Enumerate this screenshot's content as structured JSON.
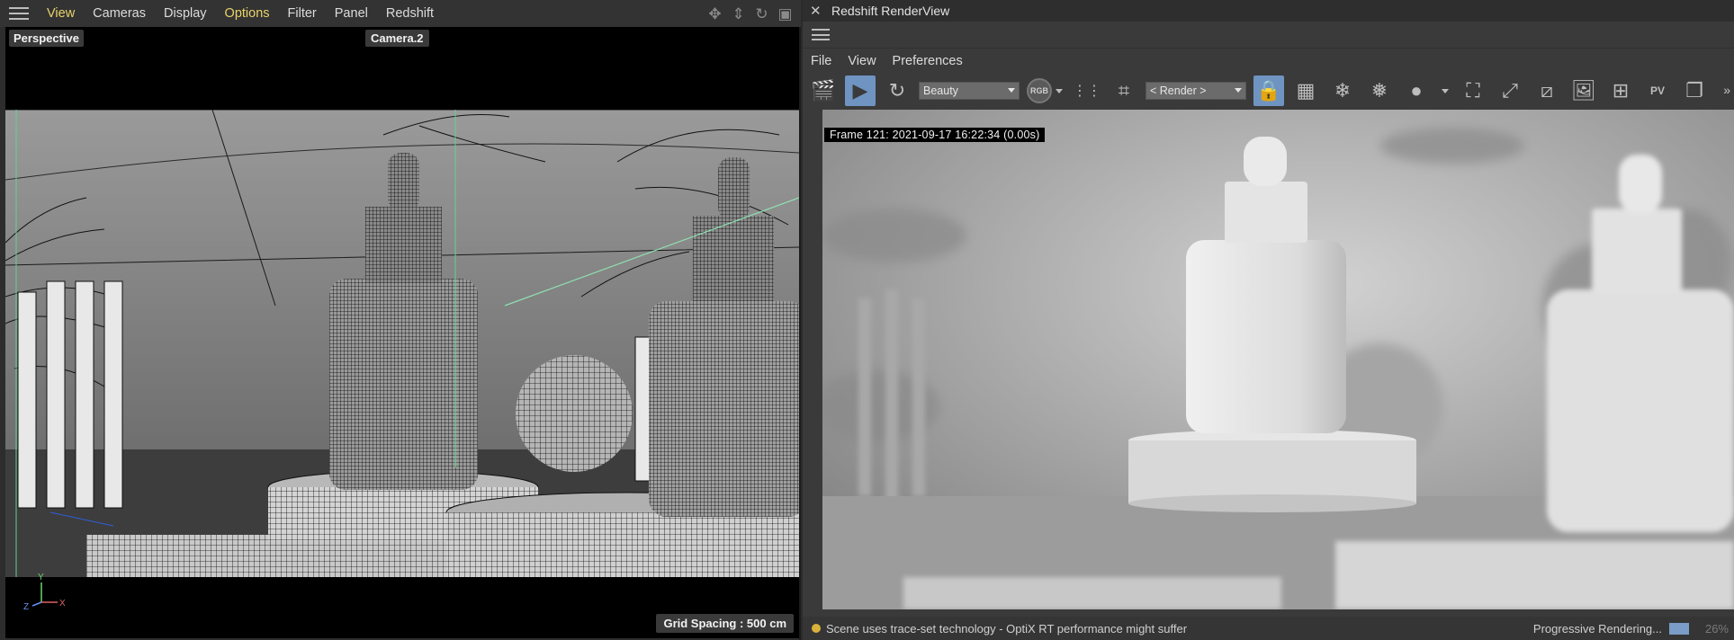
{
  "left_panel": {
    "menu": [
      "View",
      "Cameras",
      "Display",
      "Options",
      "Filter",
      "Panel",
      "Redshift"
    ],
    "highlighted_menus": [
      "View",
      "Options"
    ],
    "viewport_label": "Perspective",
    "camera_label": "Camera.2",
    "grid_spacing": "Grid Spacing : 500 cm",
    "axis": {
      "y": "Y",
      "z": "Z",
      "x": "X"
    },
    "nav_icons": [
      "move-icon",
      "zoom-icon",
      "rotate-icon",
      "maximize-icon"
    ]
  },
  "render_view": {
    "title": "Redshift RenderView",
    "close_glyph": "✕",
    "menu": [
      "File",
      "View",
      "Preferences"
    ],
    "aov_select": "Beauty",
    "rgb_label": "RGB",
    "camera_select": "< Render >",
    "frame_info": "Frame  121:  2021-09-17  16:22:34  (0.00s)",
    "status_message": "Scene uses trace-set technology - OptiX RT performance might suffer",
    "progress_label": "Progressive Rendering...",
    "progress_percent": "26%",
    "progress_value": 0.26,
    "more_glyph": "»"
  },
  "colors": {
    "menu_highlight": "#e8d36a",
    "active_button": "#6f94c2",
    "status_dot": "#d9b13a"
  }
}
